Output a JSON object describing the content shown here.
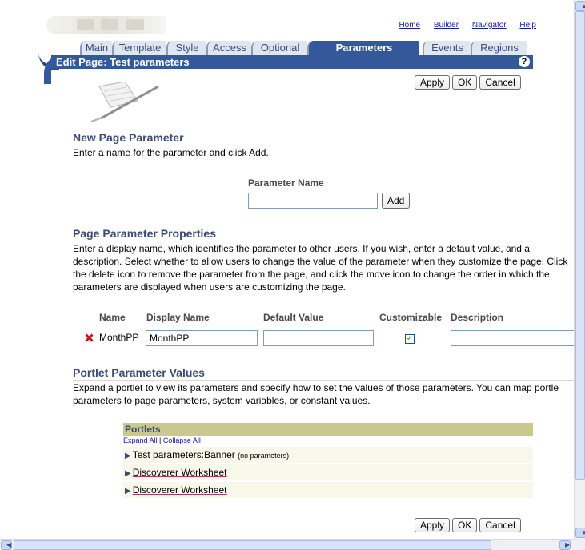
{
  "global_links": [
    "Home",
    "Builder",
    "Navigator",
    "Help"
  ],
  "tabs": [
    "Main",
    "Template",
    "Style",
    "Access",
    "Optional",
    "Parameters",
    "Events",
    "Regions"
  ],
  "active_tab": "Parameters",
  "page_title": "Edit Page: Test parameters",
  "help_glyph": "?",
  "buttons": {
    "apply": "Apply",
    "ok": "OK",
    "cancel": "Cancel",
    "add": "Add"
  },
  "new_param": {
    "heading": "New Page Parameter",
    "desc": "Enter a name for the parameter and click Add.",
    "field_label": "Parameter Name",
    "field_value": ""
  },
  "props": {
    "heading": "Page Parameter Properties",
    "desc": "Enter a display name, which identifies the parameter to other users. If you wish, enter a default value, and a description. Select whether to allow users to change the value of the parameter when they customize the page. Click the delete icon to remove the parameter from the page, and click the move icon to change the order in which the parameters are displayed when users are customizing the page.",
    "columns": [
      "Name",
      "Display Name",
      "Default Value",
      "Customizable",
      "Description"
    ],
    "row": {
      "name": "MonthPP",
      "display_name": "MonthPP",
      "default_value": "",
      "customizable": true,
      "description": ""
    }
  },
  "portlet_params": {
    "heading": "Portlet Parameter Values",
    "desc": "Expand a portlet to view its parameters and specify how to set the values of those parameters. You can map portle parameters to page parameters, system variables, or constant values.",
    "list_header": "Portlets",
    "expand_all": "Expand All",
    "separator": "|",
    "collapse_all": "Collapse All",
    "items": [
      {
        "label": "Test parameters:Banner",
        "note": "(no parameters)",
        "link": false
      },
      {
        "label": "Discoverer Worksheet",
        "note": "",
        "link": true
      },
      {
        "label": "Discoverer Worksheet",
        "note": "",
        "link": true
      }
    ]
  }
}
